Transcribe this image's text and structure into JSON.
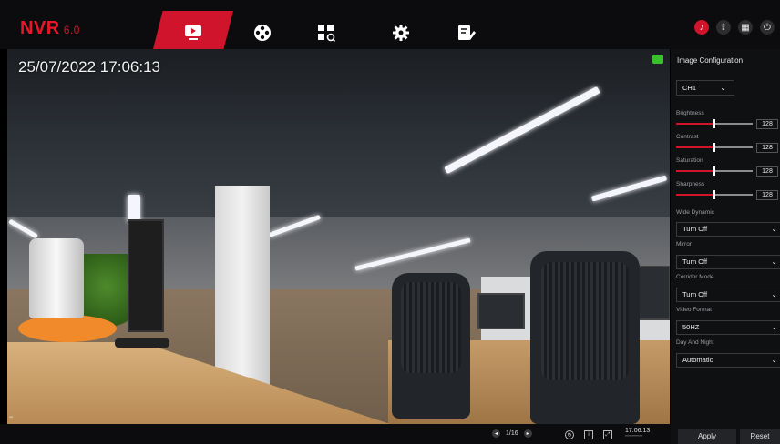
{
  "topbar": {
    "logo": "NVR",
    "version": "6.0",
    "nav": [
      {
        "name": "live-view-icon",
        "glyph": "▣"
      },
      {
        "name": "playback-icon",
        "glyph": "✇"
      },
      {
        "name": "search-icon",
        "glyph": "⌕"
      },
      {
        "name": "settings-icon",
        "glyph": "⚙"
      },
      {
        "name": "maintenance-icon",
        "glyph": "✎"
      }
    ],
    "right_icons": [
      "alarm-icon",
      "backup-icon",
      "layout-icon",
      "power-icon"
    ]
  },
  "video": {
    "timestamp": "25/07/2022  17:06:13"
  },
  "panel": {
    "title": "Image Configuration",
    "channel": "CH1",
    "sliders": [
      {
        "label": "Brightness",
        "value": "128",
        "level": 0.5
      },
      {
        "label": "Contrast",
        "value": "128",
        "level": 0.5
      },
      {
        "label": "Saturation",
        "value": "128",
        "level": 0.5
      },
      {
        "label": "Sharpness",
        "value": "128",
        "level": 0.5
      }
    ],
    "selects": [
      {
        "label": "Wide Dynamic",
        "value": "Turn Off"
      },
      {
        "label": "Mirror",
        "value": "Turn Off"
      },
      {
        "label": "Corridor Mode",
        "value": "Turn Off"
      },
      {
        "label": "Video Format",
        "value": "50HZ"
      },
      {
        "label": "Day And Night",
        "value": "Automatic"
      }
    ],
    "apply_label": "Apply",
    "reset_label": "Reset"
  },
  "bottombar": {
    "page": "1/16",
    "time": "17:06:13"
  },
  "colors": {
    "accent": "#d0142b",
    "panel_bg": "#0f1012",
    "rec": "#38c12a"
  }
}
